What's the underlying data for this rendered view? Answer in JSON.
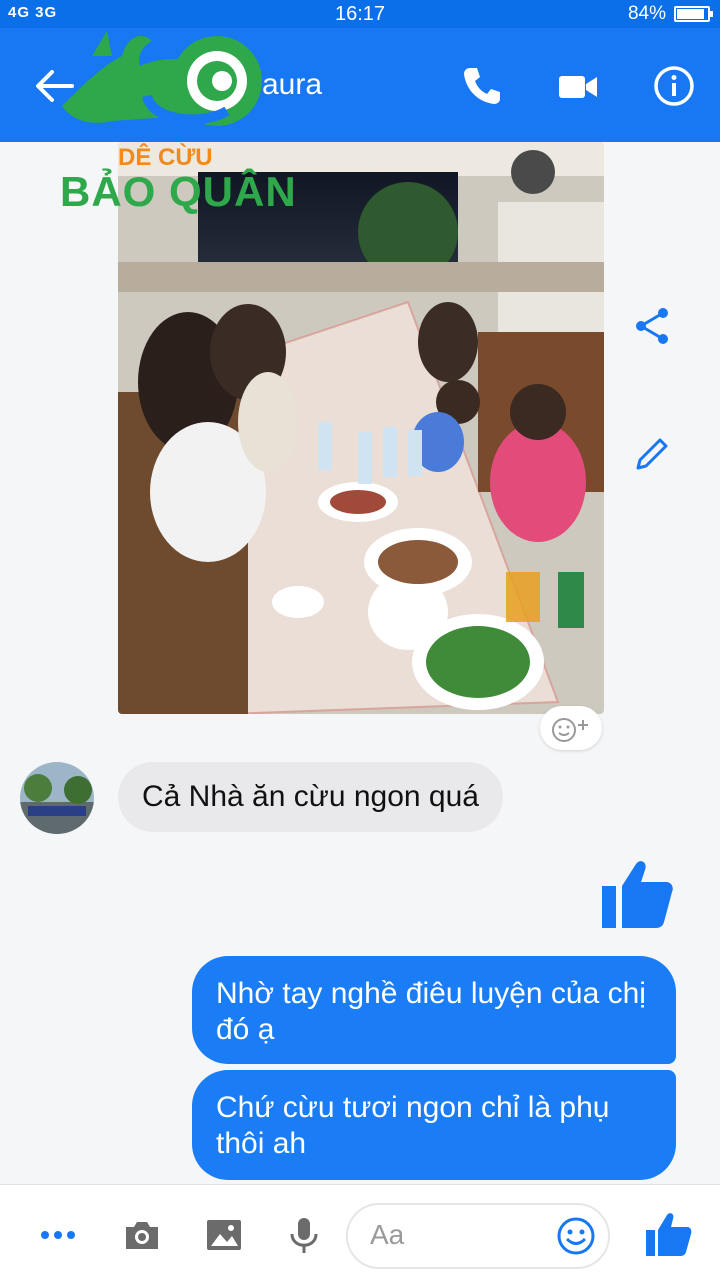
{
  "status_bar": {
    "network": "4G 3G",
    "time": "16:17",
    "battery": "84%",
    "battery_level": 0.84
  },
  "header": {
    "contact_name": "aura",
    "icons": [
      "back-arrow-icon",
      "phone-icon",
      "video-camera-icon",
      "info-icon"
    ]
  },
  "watermark": {
    "line1": "DÊ CỪU",
    "line2": "BẢO QUÂN"
  },
  "conversation": {
    "incoming": [
      {
        "text": "Cả Nhà ăn cừu ngon quá"
      }
    ],
    "outgoing": [
      {
        "text": "Nhờ tay nghề điêu luyện của chị đó ạ"
      },
      {
        "text": "Chứ cừu tươi ngon chỉ là phụ thôi ah"
      }
    ]
  },
  "composer": {
    "placeholder": "Aa",
    "icons": [
      "more-icon",
      "camera-icon",
      "gallery-icon",
      "microphone-icon",
      "emoji-icon",
      "like-icon"
    ]
  },
  "colors": {
    "brand_blue": "#1877f2",
    "bubble_out": "#1a7df6",
    "bubble_in": "#e9e9eb"
  }
}
